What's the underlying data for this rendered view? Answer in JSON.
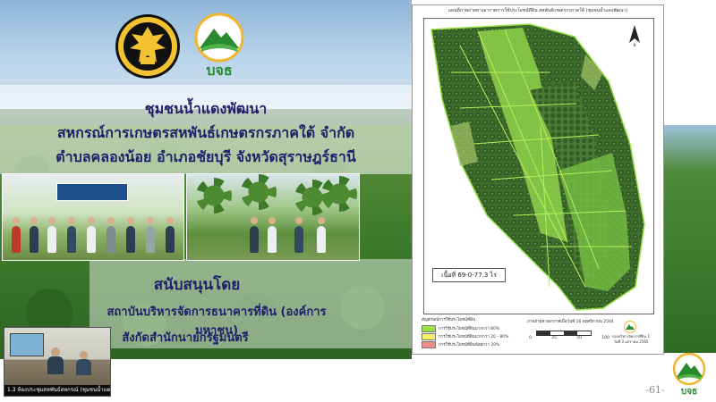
{
  "slide": {
    "title_line1": "ชุมชนน้ำแดงพัฒนา",
    "title_line2": "สหกรณ์การเกษตรสหพันธ์เกษตรกรภาคใต้ จำกัด",
    "title_line3": "ตำบลคลองน้อย อำเภอชัยบุรี จังหวัดสุราษฎร์ธานี",
    "support_heading": "สนับสนุนโดย",
    "support_line1": "สถาบันบริหารจัดการธนาคารที่ดิน (องค์การมหาชน)",
    "support_line2": "สังกัดสำนักนายกรัฐมนตรี",
    "logo_text": "บจธ",
    "page_number": "-61-"
  },
  "map": {
    "title": "แผนที่ภาพถ่ายทางอากาศการใช้ประโยชน์ที่ดิน สหพันธ์เกษตรกรภาคใต้ (ชุมชนน้ำแดงพัฒนา)",
    "north_label": "N",
    "area": "เนื้อที่ 69-0-77.3 ไร่",
    "legend_title": "สัญลักษณ์การใช้ประโยชน์ที่ดิน",
    "legend": [
      {
        "label": "การใช้ประโยชน์ที่ดินมากกว่า 80%",
        "color": "#9be24a"
      },
      {
        "label": "การใช้ประโยชน์ที่ดินมากกว่า 20 - 80%",
        "color": "#f4f06a"
      },
      {
        "label": "การใช้ประโยชน์ที่ดินน้อยกว่า 20%",
        "color": "#f28b8b"
      }
    ],
    "scale_title": "ภาพถ่ายทางอากาศเมื่อวันที่ 16 พฤศจิกายน 2564",
    "scale_labels": [
      "0",
      "25",
      "50",
      "100"
    ],
    "caption_line1": "กองบริหารจัดการที่ดิน 1",
    "caption_line2": "วันที่ 3 มกราคม 2565"
  },
  "video": {
    "participant_label": "1.3 ห้องประชุมสหพันธ์สหกรณ์ (ชุมชนน้ำแดง)"
  },
  "colors": {
    "title_text": "#1f1f6b",
    "logo_green": "#2a8a2f",
    "field_green": "#9be24a"
  }
}
